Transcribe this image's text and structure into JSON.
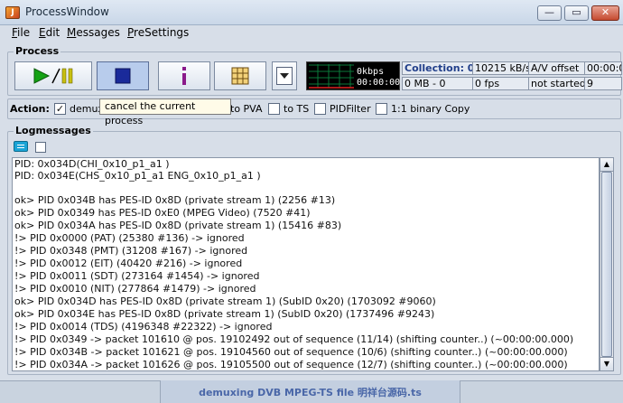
{
  "window": {
    "title": "ProcessWindow",
    "icon_glyph": "J",
    "min_glyph": "—",
    "max_glyph": "▭",
    "close_glyph": "✕"
  },
  "menu": [
    {
      "mnemonic": "F",
      "rest": "ile"
    },
    {
      "mnemonic": "E",
      "rest": "dit"
    },
    {
      "mnemonic": "M",
      "rest": "essages"
    },
    {
      "mnemonic": "P",
      "rest": "reSettings"
    }
  ],
  "process": {
    "label": "Process",
    "buttons": {
      "play_pause": "play-pause-icon",
      "stop": "stop-icon",
      "info": "info-icon",
      "grid": "grid-icon",
      "dropdown": "chevron-down-icon"
    },
    "monitor": {
      "bitrate": "0kbps",
      "time": "00:00:00"
    },
    "stats": {
      "row1": [
        "Collection: 0/0",
        "10215 kB/s",
        "A/V offset",
        "00:00:0"
      ],
      "row2": [
        "0 MB - 0",
        "0 fps",
        "not started",
        "9"
      ]
    }
  },
  "action": {
    "label": "Action:",
    "options": [
      {
        "label": "demux",
        "checked": true
      },
      {
        "label": "to PVA",
        "checked": false
      },
      {
        "label": "to TS",
        "checked": false
      },
      {
        "label": "PIDFilter",
        "checked": false
      },
      {
        "label": "1:1 binary Copy",
        "checked": false
      }
    ],
    "tooltip": "cancel the current process"
  },
  "log": {
    "label": "Logmessages",
    "lines": [
      "PID: 0x034D(CHI_0x10_p1_a1 )",
      "PID: 0x034E(CHS_0x10_p1_a1 ENG_0x10_p1_a1 )",
      "",
      "ok> PID 0x034B has PES-ID 0x8D (private stream 1) (2256 #13)",
      "ok> PID 0x0349 has PES-ID 0xE0 (MPEG Video) (7520 #41)",
      "ok> PID 0x034A has PES-ID 0x8D (private stream 1) (15416 #83)",
      "!> PID 0x0000 (PAT) (25380 #136) -> ignored",
      "!> PID 0x0348 (PMT) (31208 #167) -> ignored",
      "!> PID 0x0012 (EIT) (40420 #216) -> ignored",
      "!> PID 0x0011 (SDT) (273164 #1454) -> ignored",
      "!> PID 0x0010 (NIT) (277864 #1479) -> ignored",
      "ok> PID 0x034D has PES-ID 0x8D (private stream 1) (SubID 0x20) (1703092 #9060)",
      "ok> PID 0x034E has PES-ID 0x8D (private stream 1) (SubID 0x20) (1737496 #9243)",
      "!> PID 0x0014 (TDS) (4196348 #22322) -> ignored",
      "!> PID 0x0349 -> packet 101610 @ pos. 19102492 out of sequence (11/14) (shifting counter..) (~00:00:00.000)",
      "!> PID 0x034B -> packet 101621 @ pos. 19104560 out of sequence (10/6) (shifting counter..) (~00:00:00.000)",
      "!> PID 0x034A -> packet 101626 @ pos. 19105500 out of sequence (12/7) (shifting counter..) (~00:00:00.000)"
    ]
  },
  "status": {
    "text": "demuxing DVB MPEG-TS file 明祥台源码.ts"
  }
}
